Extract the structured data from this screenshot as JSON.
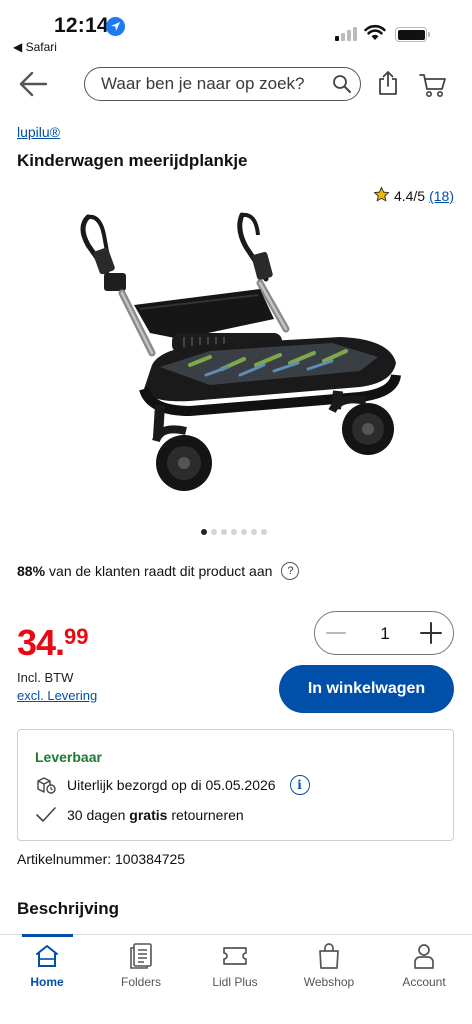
{
  "status_bar": {
    "time": "12:14",
    "back_app": "◀ Safari"
  },
  "header": {
    "search_placeholder": "Waar ben je naar op zoek?"
  },
  "product": {
    "brand": "lupilu®",
    "title": "Kinderwagen meerijdplankje",
    "rating": "4.4/5",
    "review_count": "(18)",
    "image_count": 7,
    "active_image": 1,
    "recommend_percent": "88%",
    "recommend_text": "van de klanten raadt dit product aan",
    "price_int": "34.",
    "price_dec": "99",
    "incl_vat": "Incl. BTW",
    "excl_delivery": "excl. Levering",
    "quantity": "1",
    "add_to_cart": "In winkelwagen",
    "article_number": "Artikelnummer: 100384725"
  },
  "delivery": {
    "status": "Leverbaar",
    "delivery_text": "Uiterlijk bezorgd op di 05.05.2026",
    "return_prefix": "30 dagen",
    "return_bold": "gratis",
    "return_suffix": "retourneren"
  },
  "description": {
    "heading": "Beschrijving"
  },
  "tabs": [
    {
      "label": "Home",
      "icon": "home-icon",
      "active": true
    },
    {
      "label": "Folders",
      "icon": "folders-icon",
      "active": false
    },
    {
      "label": "Lidl Plus",
      "icon": "ticket-icon",
      "active": false
    },
    {
      "label": "Webshop",
      "icon": "shopping-bag-icon",
      "active": false
    },
    {
      "label": "Account",
      "icon": "account-icon",
      "active": false
    }
  ],
  "colors": {
    "brand_blue": "#0050aa",
    "price_red": "#e60a14",
    "available_green": "#1a7a32"
  }
}
